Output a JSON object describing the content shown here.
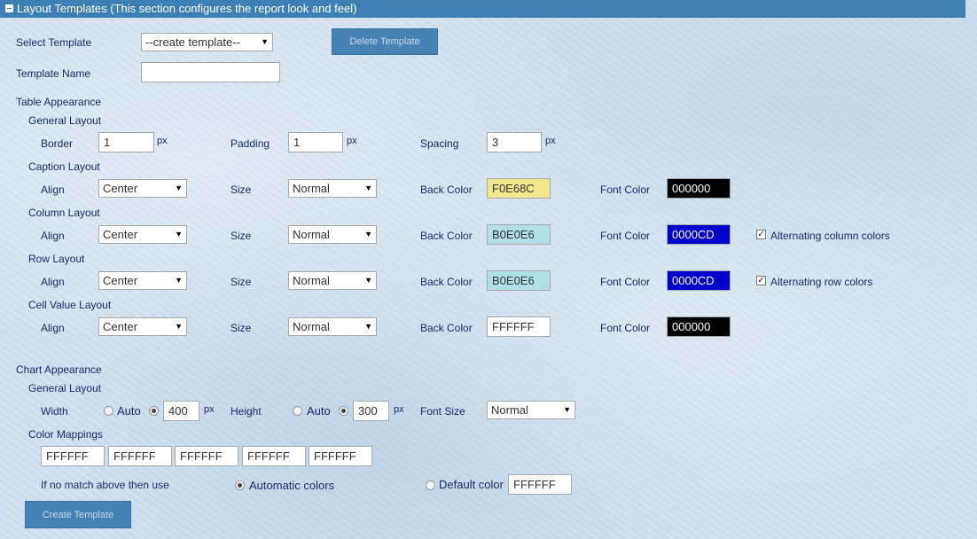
{
  "section": {
    "collapse_icon": "minus-square-icon",
    "title": "Layout Templates (This section configures the report look and feel)"
  },
  "select_template": {
    "label": "Select Template",
    "value": "--create template--"
  },
  "delete_button": "Delete Template",
  "template_name": {
    "label": "Template Name",
    "value": ""
  },
  "table": {
    "heading": "Table Appearance",
    "general": {
      "heading": "General Layout",
      "border_label": "Border",
      "border_value": "1",
      "padding_label": "Padding",
      "padding_value": "1",
      "spacing_label": "Spacing",
      "spacing_value": "3",
      "unit": "px"
    },
    "caption": {
      "heading": "Caption Layout",
      "align_label": "Align",
      "align": "Center",
      "size_label": "Size",
      "size": "Normal",
      "back_label": "Back Color",
      "back": "F0E68C",
      "font_label": "Font Color",
      "font": "000000"
    },
    "column": {
      "heading": "Column Layout",
      "align_label": "Align",
      "align": "Center",
      "size_label": "Size",
      "size": "Normal",
      "back_label": "Back Color",
      "back": "B0E0E6",
      "font_label": "Font Color",
      "font": "0000CD",
      "alt_label": "Alternating column colors",
      "alt_checked": true
    },
    "row": {
      "heading": "Row Layout",
      "align_label": "Align",
      "align": "Center",
      "size_label": "Size",
      "size": "Normal",
      "back_label": "Back Color",
      "back": "B0E0E6",
      "font_label": "Font Color",
      "font": "0000CD",
      "alt_label": "Alternating row colors",
      "alt_checked": true
    },
    "cell": {
      "heading": "Cell Value Layout",
      "align_label": "Align",
      "align": "Center",
      "size_label": "Size",
      "size": "Normal",
      "back_label": "Back Color",
      "back": "FFFFFF",
      "font_label": "Font Color",
      "font": "000000"
    }
  },
  "chart": {
    "heading": "Chart Appearance",
    "general_heading": "General Layout",
    "width_label": "Width",
    "width_auto": "Auto",
    "width_value": "400",
    "height_label": "Height",
    "height_auto": "Auto",
    "height_value": "300",
    "unit": "px",
    "font_size_label": "Font Size",
    "font_size": "Normal",
    "color_mappings_label": "Color Mappings",
    "mappings": [
      "FFFFFF",
      "FFFFFF",
      "FFFFFF",
      "FFFFFF",
      "FFFFFF"
    ],
    "fallback_label": "If no match above then use",
    "automatic_label": "Automatic colors",
    "default_label": "Default color",
    "default_value": "FFFFFF"
  },
  "create_button": "Create Template",
  "colors": {
    "header_bg": "#3e7fb6",
    "button_bg": "#4682b4",
    "label_text": "#1a2a6c"
  }
}
